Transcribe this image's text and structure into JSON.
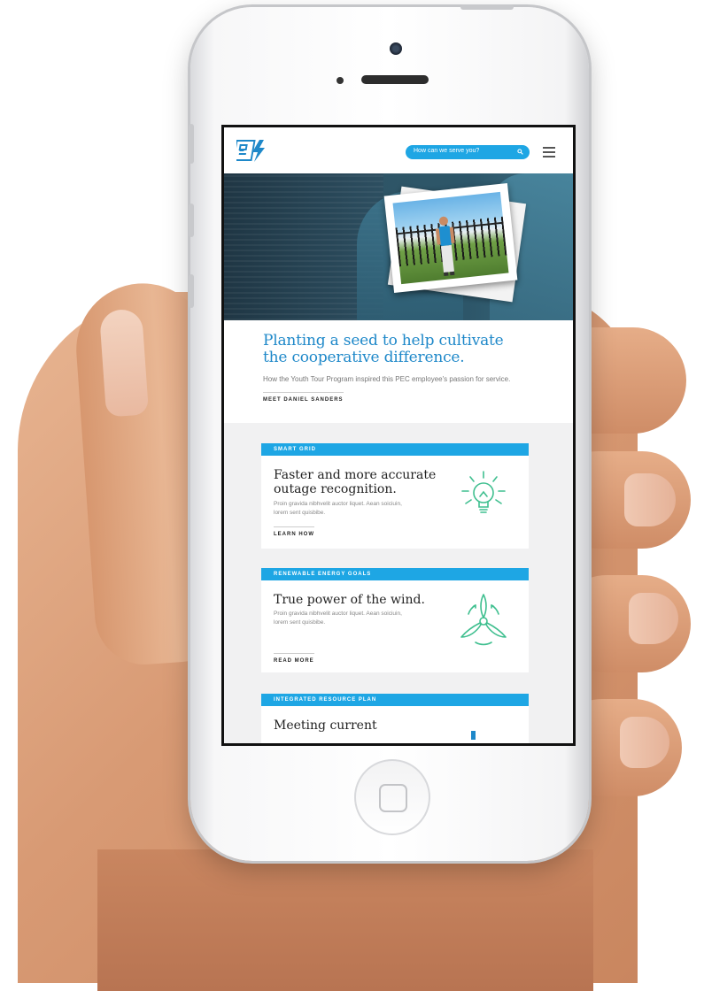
{
  "search": {
    "placeholder": "How can we serve you?"
  },
  "hero": {
    "headline_line1": "Planting a seed to help cultivate",
    "headline_line2": "the cooperative difference.",
    "subtext": "How the Youth Tour Program inspired this PEC employee's passion for service.",
    "cta": "MEET DANIEL SANDERS"
  },
  "cards": [
    {
      "tag": "SMART GRID",
      "title_line1": "Faster and more accurate",
      "title_line2": "outage recognition.",
      "body_line1": "Proin gravida nibhvelit auctor liquet. Aean soiciuin,",
      "body_line2": "lorem sent quisbibe.",
      "link": "LEARN HOW",
      "icon": "lightbulb-icon"
    },
    {
      "tag": "RENEWABLE ENERGY GOALS",
      "title_line1": "True power of the wind.",
      "body_line1": "Proin gravida nibhvelit auctor liquet. Aean soiciuin,",
      "body_line2": "lorem sent quisbibe.",
      "link": "READ MORE",
      "icon": "wind-turbine-icon"
    },
    {
      "tag": "INTEGRATED RESOURCE PLAN",
      "title_line1": "Meeting current"
    }
  ],
  "colors": {
    "accent": "#1ea6e4",
    "headline": "#1e88c9",
    "icon_green": "#3fbf8f"
  }
}
